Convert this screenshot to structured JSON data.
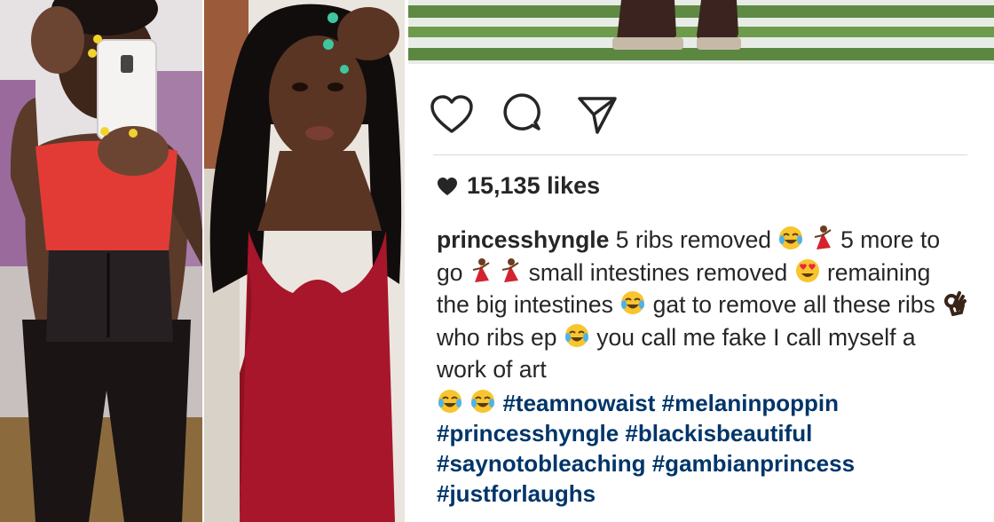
{
  "post": {
    "likes": "15,135 likes",
    "username": "princesshyngle",
    "caption": {
      "seg1": "5 ribs removed",
      "seg2": "5 more to go",
      "seg3": "small intestines removed",
      "seg4": "remaining the big intestines",
      "seg5": "gat to remove all these ribs",
      "seg6": "who ribs ep",
      "seg7": "you call me fake I call myself a work of art"
    },
    "hashtags": {
      "line1": "#teamnowaist #melaninpoppin",
      "line2": "#princesshyngle #blackisbeautiful",
      "line3": "#saynotobleaching #gambianprincess",
      "line4": "#justforlaughs"
    }
  },
  "icons": {
    "like": "heart-outline-icon",
    "comment": "comment-bubble-icon",
    "share": "paper-plane-icon",
    "likes_badge": "heart-filled-icon"
  },
  "colors": {
    "text": "#262626",
    "hashtag": "#003569",
    "divider": "#d8d8d8",
    "top_red": "#e23b36",
    "dress_red": "#a7162a"
  }
}
